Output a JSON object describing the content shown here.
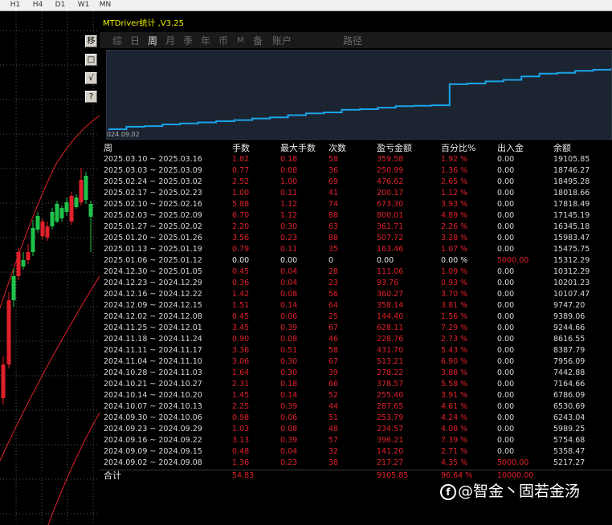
{
  "timeframes": [
    "H1",
    "H4",
    "D1",
    "W1",
    "MN"
  ],
  "side_buttons": [
    "移",
    "□",
    "√",
    "?"
  ],
  "panel": {
    "title": "MTDriver统计 ,V3.25",
    "tabs": [
      "综",
      "日",
      "周",
      "月",
      "季",
      "年",
      "币",
      "M",
      "备",
      "账户",
      "路径"
    ],
    "active_tab": "周"
  },
  "equity_chart": {
    "start_label": "024.09.02",
    "line_color": "#1aa3e8",
    "background": "#1c2432"
  },
  "table": {
    "headers": [
      "周",
      "手数",
      "最大手数",
      "次数",
      "盈亏金额",
      "百分比%",
      "出入金",
      "余额"
    ],
    "rows": [
      {
        "date": "2025.03.10 ~ 2025.03.16",
        "lots": "1.82",
        "max_lots": "0.18",
        "count": "58",
        "pnl": "359.58",
        "pct": "1.92 %",
        "flow": "0.00",
        "balance": "19105.85"
      },
      {
        "date": "2025.03.03 ~ 2025.03.09",
        "lots": "0.77",
        "max_lots": "0.08",
        "count": "36",
        "pnl": "250.99",
        "pct": "1.36 %",
        "flow": "0.00",
        "balance": "18746.27"
      },
      {
        "date": "2025.02.24 ~ 2025.03.02",
        "lots": "2.52",
        "max_lots": "1.00",
        "count": "69",
        "pnl": "476.62",
        "pct": "2.65 %",
        "flow": "0.00",
        "balance": "18495.28"
      },
      {
        "date": "2025.02.17 ~ 2025.02.23",
        "lots": "1.00",
        "max_lots": "0.11",
        "count": "41",
        "pnl": "200.17",
        "pct": "1.12 %",
        "flow": "0.00",
        "balance": "18018.66"
      },
      {
        "date": "2025.02.10 ~ 2025.02.16",
        "lots": "5.88",
        "max_lots": "1.12",
        "count": "74",
        "pnl": "673.30",
        "pct": "3.93 %",
        "flow": "0.00",
        "balance": "17818.49"
      },
      {
        "date": "2025.02.03 ~ 2025.02.09",
        "lots": "6.70",
        "max_lots": "1.12",
        "count": "88",
        "pnl": "800.01",
        "pct": "4.89 %",
        "flow": "0.00",
        "balance": "17145.19"
      },
      {
        "date": "2025.01.27 ~ 2025.02.02",
        "lots": "2.20",
        "max_lots": "0.30",
        "count": "63",
        "pnl": "361.71",
        "pct": "2.26 %",
        "flow": "0.00",
        "balance": "16345.18"
      },
      {
        "date": "2025.01.20 ~ 2025.01.26",
        "lots": "3.56",
        "max_lots": "0.23",
        "count": "88",
        "pnl": "507.72",
        "pct": "3.28 %",
        "flow": "0.00",
        "balance": "15983.47"
      },
      {
        "date": "2025.01.13 ~ 2025.01.19",
        "lots": "0.79",
        "max_lots": "0.11",
        "count": "35",
        "pnl": "163.46",
        "pct": "1.07 %",
        "flow": "0.00",
        "balance": "15475.75"
      },
      {
        "date": "2025.01.06 ~ 2025.01.12",
        "lots": "0.00",
        "max_lots": "0.00",
        "count": "0",
        "pnl": "0.00",
        "pct": "0.00 %",
        "flow": "5000.00",
        "balance": "15312.29",
        "zero": true,
        "flow_red": true
      },
      {
        "date": "2024.12.30 ~ 2025.01.05",
        "lots": "0.45",
        "max_lots": "0.04",
        "count": "28",
        "pnl": "111.06",
        "pct": "1.09 %",
        "flow": "0.00",
        "balance": "10312.29"
      },
      {
        "date": "2024.12.23 ~ 2024.12.29",
        "lots": "0.36",
        "max_lots": "0.04",
        "count": "23",
        "pnl": "93.76",
        "pct": "0.93 %",
        "flow": "0.00",
        "balance": "10201.23"
      },
      {
        "date": "2024.12.16 ~ 2024.12.22",
        "lots": "1.42",
        "max_lots": "0.08",
        "count": "56",
        "pnl": "360.27",
        "pct": "3.70 %",
        "flow": "0.00",
        "balance": "10107.47"
      },
      {
        "date": "2024.12.09 ~ 2024.12.15",
        "lots": "1.51",
        "max_lots": "0.14",
        "count": "64",
        "pnl": "358.14",
        "pct": "3.81 %",
        "flow": "0.00",
        "balance": "9747.20"
      },
      {
        "date": "2024.12.02 ~ 2024.12.08",
        "lots": "0.45",
        "max_lots": "0.06",
        "count": "25",
        "pnl": "144.40",
        "pct": "1.56 %",
        "flow": "0.00",
        "balance": "9389.06"
      },
      {
        "date": "2024.11.25 ~ 2024.12.01",
        "lots": "3.45",
        "max_lots": "0.39",
        "count": "67",
        "pnl": "628.11",
        "pct": "7.29 %",
        "flow": "0.00",
        "balance": "9244.66"
      },
      {
        "date": "2024.11.18 ~ 2024.11.24",
        "lots": "0.90",
        "max_lots": "0.08",
        "count": "46",
        "pnl": "228.76",
        "pct": "2.73 %",
        "flow": "0.00",
        "balance": "8616.55"
      },
      {
        "date": "2024.11.11 ~ 2024.11.17",
        "lots": "3.36",
        "max_lots": "0.51",
        "count": "58",
        "pnl": "431.70",
        "pct": "5.43 %",
        "flow": "0.00",
        "balance": "8387.79"
      },
      {
        "date": "2024.11.04 ~ 2024.11.10",
        "lots": "3.06",
        "max_lots": "0.30",
        "count": "67",
        "pnl": "513.21",
        "pct": "6.90 %",
        "flow": "0.00",
        "balance": "7956.09"
      },
      {
        "date": "2024.10.28 ~ 2024.11.03",
        "lots": "1.64",
        "max_lots": "0.30",
        "count": "39",
        "pnl": "278.22",
        "pct": "3.88 %",
        "flow": "0.00",
        "balance": "7442.88"
      },
      {
        "date": "2024.10.21 ~ 2024.10.27",
        "lots": "2.31",
        "max_lots": "0.18",
        "count": "66",
        "pnl": "378.57",
        "pct": "5.58 %",
        "flow": "0.00",
        "balance": "7164.66"
      },
      {
        "date": "2024.10.14 ~ 2024.10.20",
        "lots": "1.45",
        "max_lots": "0.14",
        "count": "52",
        "pnl": "255.40",
        "pct": "3.91 %",
        "flow": "0.00",
        "balance": "6786.09"
      },
      {
        "date": "2024.10.07 ~ 2024.10.13",
        "lots": "2.25",
        "max_lots": "0.39",
        "count": "44",
        "pnl": "287.65",
        "pct": "4.61 %",
        "flow": "0.00",
        "balance": "6530.69"
      },
      {
        "date": "2024.09.30 ~ 2024.10.06",
        "lots": "0.98",
        "max_lots": "0.06",
        "count": "51",
        "pnl": "253.79",
        "pct": "4.24 %",
        "flow": "0.00",
        "balance": "6243.04"
      },
      {
        "date": "2024.09.23 ~ 2024.09.29",
        "lots": "1.03",
        "max_lots": "0.08",
        "count": "48",
        "pnl": "234.57",
        "pct": "4.08 %",
        "flow": "0.00",
        "balance": "5989.25"
      },
      {
        "date": "2024.09.16 ~ 2024.09.22",
        "lots": "3.13",
        "max_lots": "0.39",
        "count": "57",
        "pnl": "396.21",
        "pct": "7.39 %",
        "flow": "0.00",
        "balance": "5754.68"
      },
      {
        "date": "2024.09.09 ~ 2024.09.15",
        "lots": "0.48",
        "max_lots": "0.04",
        "count": "32",
        "pnl": "141.20",
        "pct": "2.71 %",
        "flow": "0.00",
        "balance": "5358.47"
      },
      {
        "date": "2024.09.02 ~ 2024.09.08",
        "lots": "1.36",
        "max_lots": "0.23",
        "count": "38",
        "pnl": "217.27",
        "pct": "4.35 %",
        "flow": "5000.00",
        "balance": "5217.27",
        "flow_red": true
      }
    ],
    "total": {
      "label": "合计",
      "lots": "54.83",
      "pnl": "9105.85",
      "pct": "96.64 %",
      "flow": "10000.00"
    }
  },
  "watermark": {
    "logo": "f",
    "text": "@智金丶固若金汤"
  },
  "colors": {
    "up": "#1fc34a",
    "down": "#e0202a",
    "band": "#e0202a",
    "equity": "#1aa3e8"
  }
}
